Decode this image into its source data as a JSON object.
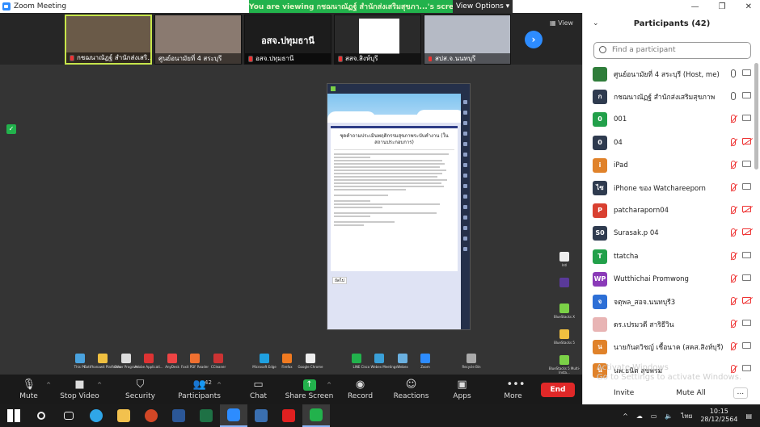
{
  "window": {
    "title": "Zoom Meeting"
  },
  "banner": {
    "text": "You are viewing กชฌนาณัฏฐ์ สำนักส่งเสริมสุขภา...'s screen",
    "view_options": "View Options"
  },
  "thumbnails": [
    {
      "name": "กชฌนาณัฏฐ์ สำนักส่งเสริ...",
      "active": true
    },
    {
      "name": "ศูนย์อนามัยที่ 4 สระบุรี",
      "active": false
    },
    {
      "name": "อสจ.ปทุมธานี",
      "big_name": "อสจ.ปทุมธานี",
      "active": false
    },
    {
      "name": "สสจ.สิงห์บุรี",
      "active": false
    },
    {
      "name": "สปส.จ.นนทบุรี",
      "active": false
    }
  ],
  "view_label": "View",
  "app_window": {
    "heading": "ชุดคำถามประเมินพฤติกรรมสุขภาพระบับคำงาน (ในสถานประกอบการ)",
    "next_button": "ถัดไป"
  },
  "toolbar": {
    "mute": "Mute",
    "stop_video": "Stop Video",
    "security": "Security",
    "participants": "Participants",
    "participants_count": "42",
    "chat": "Chat",
    "share_screen": "Share Screen",
    "record": "Record",
    "reactions": "Reactions",
    "apps": "Apps",
    "more": "More",
    "end": "End"
  },
  "panel": {
    "title": "Participants (42)",
    "search_placeholder": "Find a participant",
    "participants": [
      {
        "initials": "",
        "name": "ศูนย์อนามัยที่ 4 สระบุรี (Host, me)",
        "color": "#2f7d3a",
        "mic_muted": false,
        "cam_muted": false
      },
      {
        "initials": "ก",
        "name": "กชฌนาณัฏฐ์ สำนักส่งเสริมสุขภาพ",
        "color": "#2f3b4f",
        "mic_muted": false,
        "cam_muted": false
      },
      {
        "initials": "0",
        "name": "001",
        "color": "#22a04a",
        "mic_muted": true,
        "cam_muted": false
      },
      {
        "initials": "0",
        "name": "04",
        "color": "#2f3b4f",
        "mic_muted": true,
        "cam_muted": true
      },
      {
        "initials": "i",
        "name": "iPad",
        "color": "#e0822a",
        "mic_muted": true,
        "cam_muted": false
      },
      {
        "initials": "ไซ",
        "name": "iPhone ของ Watchareeporn",
        "color": "#2f3b4f",
        "mic_muted": true,
        "cam_muted": false
      },
      {
        "initials": "P",
        "name": "patcharaporn04",
        "color": "#d94030",
        "mic_muted": true,
        "cam_muted": true
      },
      {
        "initials": "S0",
        "name": "Surasak.p 04",
        "color": "#2f3b4f",
        "mic_muted": true,
        "cam_muted": true
      },
      {
        "initials": "T",
        "name": "ttatcha",
        "color": "#22a04a",
        "mic_muted": true,
        "cam_muted": false
      },
      {
        "initials": "WP",
        "name": "Wutthichai Promwong",
        "color": "#8a3ab8",
        "mic_muted": true,
        "cam_muted": false
      },
      {
        "initials": "จ",
        "name": "จตุพล_สอจ.นนทบุรี3",
        "color": "#2d6fd6",
        "mic_muted": true,
        "cam_muted": true
      },
      {
        "initials": "",
        "name": "ดร.เปรมวดี สาริธีวิน",
        "color": "#e8b4b4",
        "mic_muted": true,
        "cam_muted": false
      },
      {
        "initials": "น",
        "name": "นายกันตวิชญ์ เชื้อนาค (สคส.สิงห์บุรี)",
        "color": "#e0822a",
        "mic_muted": true,
        "cam_muted": false
      },
      {
        "initials": "น",
        "name": "นพ.ธนิต สุขพรม",
        "color": "#e0822a",
        "mic_muted": true,
        "cam_muted": false
      }
    ],
    "watermark_line1": "Activate Windows",
    "watermark_line2": "Go to Settings to activate Windows.",
    "invite": "Invite",
    "mute_all": "Mute All",
    "more": "..."
  },
  "taskbar": {
    "time": "10:15",
    "date": "28/12/2564",
    "lang": "ไทย"
  },
  "desktop_icons": [
    "This PC",
    "Rottfhanawit Platforms",
    "Other Program",
    "Adobe Applicati...",
    "AnyDesk",
    "Foxit PDF Reader",
    "CCleaner",
    "Microsoft Edge",
    "Firefox",
    "Google Chrome",
    "LINE",
    "Cisco Webex Meetings",
    "Webex",
    "Zoom",
    "Recycle Bin"
  ],
  "right_icons": [
    "Intl",
    "BlueStacks X",
    "BlueStacks 5",
    "BlueStacks 5 Multi-Insta..."
  ]
}
